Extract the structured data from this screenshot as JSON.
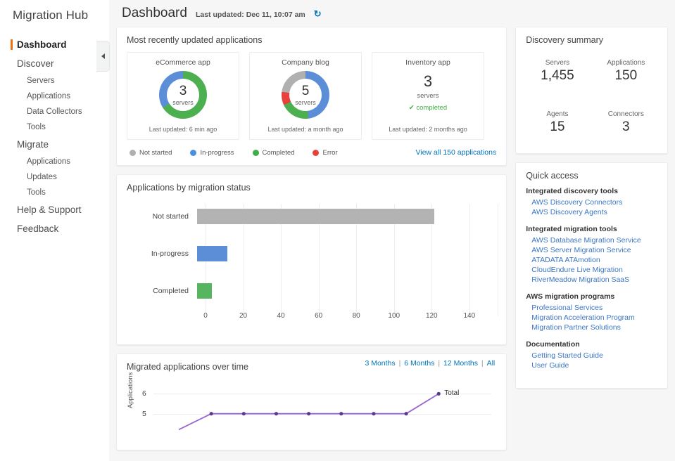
{
  "sidebar": {
    "brand": "Migration Hub",
    "items": [
      {
        "label": "Dashboard",
        "level": "top",
        "active": true
      },
      {
        "label": "Discover",
        "level": "top",
        "active": false
      },
      {
        "label": "Servers",
        "level": "sub",
        "active": false
      },
      {
        "label": "Applications",
        "level": "sub",
        "active": false
      },
      {
        "label": "Data Collectors",
        "level": "sub",
        "active": false
      },
      {
        "label": "Tools",
        "level": "sub",
        "active": false
      },
      {
        "label": "Migrate",
        "level": "top",
        "active": false
      },
      {
        "label": "Applications",
        "level": "sub",
        "active": false
      },
      {
        "label": "Updates",
        "level": "sub",
        "active": false
      },
      {
        "label": "Tools",
        "level": "sub",
        "active": false
      },
      {
        "label": "Help & Support",
        "level": "top",
        "active": false
      },
      {
        "label": "Feedback",
        "level": "top",
        "active": false
      }
    ]
  },
  "header": {
    "title": "Dashboard",
    "last_updated": "Last updated: Dec 11, 10:07 am",
    "refresh_icon": "refresh-icon",
    "refresh_glyph": "↻"
  },
  "recent_apps": {
    "title": "Most recently updated applications",
    "cards": [
      {
        "name": "eCommerce app",
        "count": "3",
        "count_unit": "servers",
        "footer": "Last updated: 6 min ago",
        "has_donut": true,
        "segments": [
          {
            "status": "Completed",
            "percent": 66,
            "color": "#4caf50"
          },
          {
            "status": "In-progress",
            "percent": 34,
            "color": "#5b8ed6"
          }
        ]
      },
      {
        "name": "Company blog",
        "count": "5",
        "count_unit": "servers",
        "footer": "Last updated: a month ago",
        "has_donut": true,
        "segments": [
          {
            "status": "In-progress",
            "percent": 48,
            "color": "#5b8ed6"
          },
          {
            "status": "Completed",
            "percent": 20,
            "color": "#4caf50"
          },
          {
            "status": "Error",
            "percent": 9,
            "color": "#e8403a"
          },
          {
            "status": "Not started",
            "percent": 23,
            "color": "#b0b0b0"
          }
        ]
      },
      {
        "name": "Inventory app",
        "count": "3",
        "count_unit": "servers",
        "footer": "Last updated: 2 months ago",
        "has_donut": false,
        "status_text": "completed",
        "status_icon": "check-icon",
        "status_glyph": "✔"
      }
    ],
    "legend": [
      {
        "label": "Not started",
        "color": "#b0b0b0"
      },
      {
        "label": "In-progress",
        "color": "#4a8fe0"
      },
      {
        "label": "Completed",
        "color": "#3fae4a"
      },
      {
        "label": "Error",
        "color": "#e8403a"
      }
    ],
    "view_all_label": "View all 150 applications"
  },
  "chart_data": [
    {
      "type": "bar",
      "orientation": "horizontal",
      "title": "Applications by migration status",
      "categories": [
        "Not started",
        "In-progress",
        "Completed"
      ],
      "values": [
        126,
        16,
        8
      ],
      "colors": [
        "#b3b3b3",
        "#5b8ed6",
        "#55b65f"
      ],
      "xlabel": "",
      "ylabel": "",
      "xlim": [
        0,
        155
      ],
      "xticks": [
        0,
        20,
        40,
        60,
        80,
        100,
        120,
        140
      ],
      "grid": true,
      "legend": false
    },
    {
      "type": "line",
      "title": "Migrated applications over time",
      "ylabel": "Applications",
      "series": [
        {
          "name": "Total",
          "color": "#9966cc",
          "values": [
            4.2,
            5,
            5,
            5,
            5,
            5,
            5,
            5,
            6
          ]
        }
      ],
      "yticks": [
        5,
        6
      ],
      "ylim": [
        4,
        6.4
      ],
      "grid": true,
      "annotation": "Total",
      "range_links": [
        "3 Months",
        "6 Months",
        "12 Months",
        "All"
      ],
      "selected_range": "All"
    }
  ],
  "discovery_summary": {
    "title": "Discovery summary",
    "stats": [
      {
        "label": "Servers",
        "value": "1,455"
      },
      {
        "label": "Applications",
        "value": "150"
      },
      {
        "label": "Agents",
        "value": "15"
      },
      {
        "label": "Connectors",
        "value": "3"
      }
    ]
  },
  "quick_access": {
    "title": "Quick access",
    "groups": [
      {
        "heading": "Integrated discovery tools",
        "links": [
          "AWS Discovery Connectors",
          "AWS Discovery Agents"
        ]
      },
      {
        "heading": "Integrated migration tools",
        "links": [
          "AWS Database Migration Service",
          "AWS Server Migration Service",
          "ATADATA ATAmotion",
          "CloudEndure Live Migration",
          "RiverMeadow Migration SaaS"
        ]
      },
      {
        "heading": "AWS migration programs",
        "links": [
          "Professional Services",
          "Migration Acceleration Program",
          "Migration Partner Solutions"
        ]
      },
      {
        "heading": "Documentation",
        "links": [
          "Getting Started Guide",
          "User Guide"
        ]
      }
    ]
  }
}
